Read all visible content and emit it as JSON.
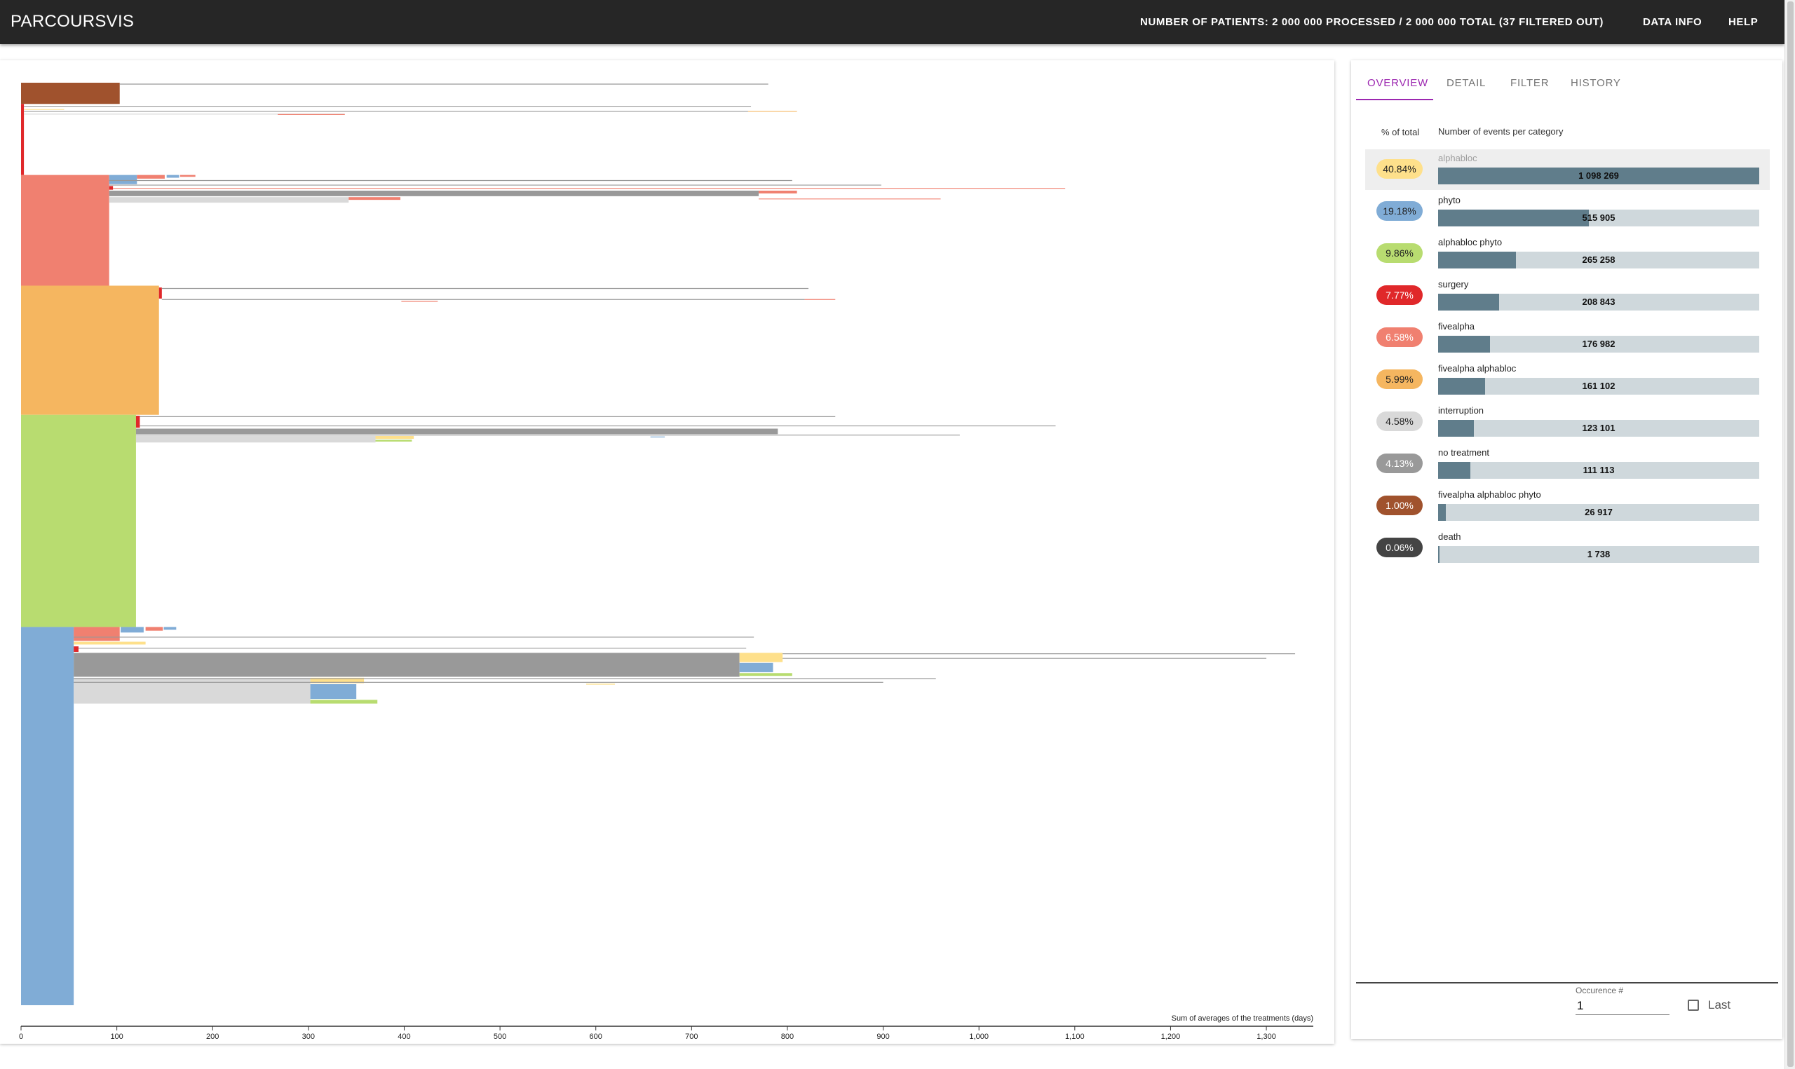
{
  "header": {
    "app_title": "PARCOURSVIS",
    "patients_info": "NUMBER OF PATIENTS: 2 000 000 PROCESSED / 2 000 000 TOTAL (37 FILTERED OUT)",
    "data_info_label": "DATA INFO",
    "help_label": "HELP"
  },
  "tabs": [
    {
      "label": "OVERVIEW",
      "active": true
    },
    {
      "label": "DETAIL",
      "active": false
    },
    {
      "label": "FILTER",
      "active": false
    },
    {
      "label": "HISTORY",
      "active": false
    }
  ],
  "overview": {
    "col_percent": "% of total",
    "col_events": "Number of events per category",
    "max_count": 1098269,
    "categories": [
      {
        "name": "alphabloc",
        "percent": "40.84%",
        "count": 1098269,
        "count_label": "1 098 269",
        "color": "#fee08b",
        "text_color": "#222222",
        "highlighted": true
      },
      {
        "name": "phyto",
        "percent": "19.18%",
        "count": 515905,
        "count_label": "515 905",
        "color": "#80acd6",
        "text_color": "#222222",
        "highlighted": false
      },
      {
        "name": "alphabloc phyto",
        "percent": "9.86%",
        "count": 265258,
        "count_label": "265 258",
        "color": "#b8dc70",
        "text_color": "#222222",
        "highlighted": false
      },
      {
        "name": "surgery",
        "percent": "7.77%",
        "count": 208843,
        "count_label": "208 843",
        "color": "#e0282a",
        "text_color": "#ffffff",
        "highlighted": false
      },
      {
        "name": "fivealpha",
        "percent": "6.58%",
        "count": 176982,
        "count_label": "176 982",
        "color": "#f08070",
        "text_color": "#ffffff",
        "highlighted": false
      },
      {
        "name": "fivealpha alphabloc",
        "percent": "5.99%",
        "count": 161102,
        "count_label": "161 102",
        "color": "#f5b660",
        "text_color": "#222222",
        "highlighted": false
      },
      {
        "name": "interruption",
        "percent": "4.58%",
        "count": 123101,
        "count_label": "123 101",
        "color": "#d9d9d9",
        "text_color": "#222222",
        "highlighted": false
      },
      {
        "name": "no treatment",
        "percent": "4.13%",
        "count": 111113,
        "count_label": "111 113",
        "color": "#999999",
        "text_color": "#ffffff",
        "highlighted": false
      },
      {
        "name": "fivealpha alphabloc phyto",
        "percent": "1.00%",
        "count": 26917,
        "count_label": "26 917",
        "color": "#a0522d",
        "text_color": "#ffffff",
        "highlighted": false
      },
      {
        "name": "death",
        "percent": "0.06%",
        "count": 1738,
        "count_label": "1 738",
        "color": "#444444",
        "text_color": "#ffffff",
        "highlighted": false
      }
    ]
  },
  "occurrence": {
    "label": "Occurence #",
    "value": "1",
    "last_label": "Last",
    "last_checked": false
  },
  "chart_data": {
    "type": "icicle",
    "xlabel": "Sum of averages of the treatments (days)",
    "ylabel": "",
    "xlim": [
      0,
      1350
    ],
    "x_ticks": [
      "0",
      "100",
      "200",
      "300",
      "400",
      "500",
      "600",
      "700",
      "800",
      "900",
      "1,000",
      "1,100",
      "1,200",
      "1,300"
    ],
    "x_tick_values": [
      0,
      100,
      200,
      300,
      400,
      500,
      600,
      700,
      800,
      900,
      1000,
      1100,
      1200,
      1300
    ],
    "total_patients": 2000000,
    "rows_note": "patients stacked top to bottom",
    "blocks": [
      {
        "category": "fivealpha alphabloc phyto",
        "x0": 0,
        "x1": 103,
        "p0": 0,
        "p1": 2.3,
        "color": "#a0522d"
      },
      {
        "category": "surgery",
        "x0": 0,
        "x1": 3,
        "p0": 2.3,
        "p1": 10,
        "color": "#e0282a"
      },
      {
        "category": "fivealpha",
        "x0": 0,
        "x1": 92,
        "p0": 10,
        "p1": 22,
        "color": "#f08070"
      },
      {
        "category": "fivealpha alphabloc",
        "x0": 0,
        "x1": 144,
        "p0": 22,
        "p1": 36,
        "color": "#f5b660"
      },
      {
        "category": "alphabloc phyto",
        "x0": 0,
        "x1": 120,
        "p0": 36,
        "p1": 59,
        "color": "#b8dc70"
      },
      {
        "category": "phyto",
        "x0": 0,
        "x1": 55,
        "p0": 59,
        "p1": 100,
        "color": "#80acd6"
      },
      {
        "category": "phyto",
        "x0": 92,
        "x1": 121,
        "p0": 10,
        "p1": 11,
        "color": "#80acd6"
      },
      {
        "category": "fivealpha",
        "x0": 121,
        "x1": 150,
        "p0": 10,
        "p1": 10.4,
        "color": "#f08070"
      },
      {
        "category": "phyto",
        "x0": 152,
        "x1": 165,
        "p0": 10,
        "p1": 10.3,
        "color": "#80acd6"
      },
      {
        "category": "fivealpha",
        "x0": 166,
        "x1": 182,
        "p0": 10,
        "p1": 10.2,
        "color": "#f08070"
      },
      {
        "category": "surgery",
        "x0": 92,
        "x1": 96,
        "p0": 11.2,
        "p1": 11.6,
        "color": "#e0282a"
      },
      {
        "category": "no treatment",
        "x0": 92,
        "x1": 770,
        "p0": 11.7,
        "p1": 12.3,
        "color": "#999999"
      },
      {
        "category": "fivealpha",
        "x0": 770,
        "x1": 810,
        "p0": 11.7,
        "p1": 12.0,
        "color": "#f08070"
      },
      {
        "category": "interruption",
        "x0": 92,
        "x1": 342,
        "p0": 12.4,
        "p1": 13.0,
        "color": "#d9d9d9"
      },
      {
        "category": "fivealpha",
        "x0": 342,
        "x1": 396,
        "p0": 12.4,
        "p1": 12.7,
        "color": "#f08070"
      },
      {
        "category": "surgery",
        "x0": 144,
        "x1": 147,
        "p0": 22.2,
        "p1": 23.4,
        "color": "#e0282a"
      },
      {
        "category": "surgery",
        "x0": 120,
        "x1": 124,
        "p0": 36.1,
        "p1": 37.4,
        "color": "#e0282a"
      },
      {
        "category": "no treatment",
        "x0": 120,
        "x1": 790,
        "p0": 37.5,
        "p1": 38.1,
        "color": "#999999"
      },
      {
        "category": "interruption",
        "x0": 120,
        "x1": 370,
        "p0": 38.3,
        "p1": 39.0,
        "color": "#d9d9d9"
      },
      {
        "category": "alphabloc",
        "x0": 370,
        "x1": 410,
        "p0": 38.3,
        "p1": 38.6,
        "color": "#fee08b"
      },
      {
        "category": "alphabloc phyto",
        "x0": 370,
        "x1": 408,
        "p0": 38.7,
        "p1": 38.9,
        "color": "#b8dc70"
      },
      {
        "category": "fivealpha",
        "x0": 55,
        "x1": 103,
        "p0": 59.0,
        "p1": 60.5,
        "color": "#f08070"
      },
      {
        "category": "phyto",
        "x0": 104,
        "x1": 128,
        "p0": 59.0,
        "p1": 59.6,
        "color": "#80acd6"
      },
      {
        "category": "fivealpha",
        "x0": 130,
        "x1": 148,
        "p0": 59.0,
        "p1": 59.4,
        "color": "#f08070"
      },
      {
        "category": "phyto",
        "x0": 149,
        "x1": 162,
        "p0": 59.0,
        "p1": 59.3,
        "color": "#80acd6"
      },
      {
        "category": "alphabloc",
        "x0": 55,
        "x1": 130,
        "p0": 60.6,
        "p1": 60.9,
        "color": "#fee08b"
      },
      {
        "category": "surgery",
        "x0": 55,
        "x1": 60,
        "p0": 61.1,
        "p1": 61.7,
        "color": "#e0282a"
      },
      {
        "category": "no treatment",
        "x0": 55,
        "x1": 750,
        "p0": 61.8,
        "p1": 64.4,
        "color": "#999999"
      },
      {
        "category": "alphabloc",
        "x0": 750,
        "x1": 795,
        "p0": 61.8,
        "p1": 62.8,
        "color": "#fee08b"
      },
      {
        "category": "phyto",
        "x0": 750,
        "x1": 785,
        "p0": 62.9,
        "p1": 63.9,
        "color": "#80acd6"
      },
      {
        "category": "alphabloc phyto",
        "x0": 750,
        "x1": 805,
        "p0": 64.0,
        "p1": 64.3,
        "color": "#b8dc70"
      },
      {
        "category": "interruption",
        "x0": 55,
        "x1": 302,
        "p0": 64.5,
        "p1": 67.3,
        "color": "#d9d9d9"
      },
      {
        "category": "alphabloc",
        "x0": 302,
        "x1": 358,
        "p0": 64.5,
        "p1": 65.1,
        "color": "#fee08b"
      },
      {
        "category": "phyto",
        "x0": 302,
        "x1": 350,
        "p0": 65.2,
        "p1": 66.8,
        "color": "#80acd6"
      },
      {
        "category": "alphabloc phyto",
        "x0": 302,
        "x1": 372,
        "p0": 66.9,
        "p1": 67.3,
        "color": "#b8dc70"
      }
    ],
    "lines": [
      {
        "x0": 103,
        "x1": 780,
        "p": 0.15,
        "color": "#999999"
      },
      {
        "x0": 3,
        "x1": 762,
        "p": 2.55,
        "color": "#999999"
      },
      {
        "x0": 3,
        "x1": 45,
        "p": 2.9,
        "color": "#fee08b"
      },
      {
        "x0": 3,
        "x1": 759,
        "p": 3.1,
        "color": "#999999"
      },
      {
        "x0": 759,
        "x1": 810,
        "p": 3.1,
        "color": "#f5b660"
      },
      {
        "x0": 3,
        "x1": 338,
        "p": 3.4,
        "color": "#d9d9d9"
      },
      {
        "x0": 268,
        "x1": 338,
        "p": 3.45,
        "color": "#f08070"
      },
      {
        "x0": 92,
        "x1": 805,
        "p": 10.6,
        "color": "#999999"
      },
      {
        "x0": 92,
        "x1": 898,
        "p": 11.1,
        "color": "#999999"
      },
      {
        "x0": 96,
        "x1": 1090,
        "p": 11.45,
        "color": "#f08070"
      },
      {
        "x0": 770,
        "x1": 960,
        "p": 12.6,
        "color": "#f08070"
      },
      {
        "x0": 147,
        "x1": 822,
        "p": 22.3,
        "color": "#999999"
      },
      {
        "x0": 147,
        "x1": 818,
        "p": 23.5,
        "color": "#999999"
      },
      {
        "x0": 818,
        "x1": 850,
        "p": 23.5,
        "color": "#f08070"
      },
      {
        "x0": 397,
        "x1": 435,
        "p": 23.7,
        "color": "#f08070"
      },
      {
        "x0": 124,
        "x1": 850,
        "p": 36.2,
        "color": "#999999"
      },
      {
        "x0": 124,
        "x1": 1080,
        "p": 37.2,
        "color": "#999999"
      },
      {
        "x0": 120,
        "x1": 980,
        "p": 38.2,
        "color": "#999999"
      },
      {
        "x0": 657,
        "x1": 672,
        "p": 38.4,
        "color": "#80acd6"
      },
      {
        "x0": 55,
        "x1": 765,
        "p": 60.1,
        "color": "#999999"
      },
      {
        "x0": 60,
        "x1": 757,
        "p": 61.3,
        "color": "#999999"
      },
      {
        "x0": 795,
        "x1": 1330,
        "p": 61.9,
        "color": "#999999"
      },
      {
        "x0": 795,
        "x1": 1300,
        "p": 62.4,
        "color": "#999999"
      },
      {
        "x0": 55,
        "x1": 955,
        "p": 64.6,
        "color": "#999999"
      },
      {
        "x0": 55,
        "x1": 900,
        "p": 65.0,
        "color": "#999999"
      },
      {
        "x0": 590,
        "x1": 620,
        "p": 65.2,
        "color": "#fee08b"
      }
    ]
  }
}
